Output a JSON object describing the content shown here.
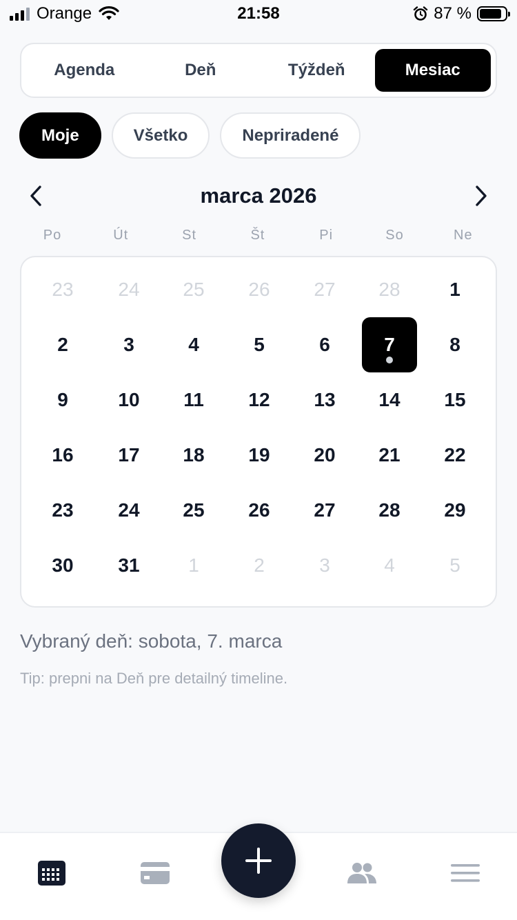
{
  "status_bar": {
    "carrier": "Orange",
    "time": "21:58",
    "battery": "87 %",
    "battery_level": 0.87
  },
  "view_switch": {
    "tabs": [
      {
        "label": "Agenda",
        "active": false
      },
      {
        "label": "Deň",
        "active": false
      },
      {
        "label": "Týždeň",
        "active": false
      },
      {
        "label": "Mesiac",
        "active": true
      }
    ]
  },
  "filters": [
    {
      "label": "Moje",
      "active": true
    },
    {
      "label": "Všetko",
      "active": false
    },
    {
      "label": "Nepriradené",
      "active": false
    }
  ],
  "calendar": {
    "month_title": "marca 2026",
    "weekdays": [
      "Po",
      "Út",
      "St",
      "Št",
      "Pi",
      "So",
      "Ne"
    ],
    "weeks": [
      [
        {
          "d": "23",
          "m": true
        },
        {
          "d": "24",
          "m": true
        },
        {
          "d": "25",
          "m": true
        },
        {
          "d": "26",
          "m": true
        },
        {
          "d": "27",
          "m": true
        },
        {
          "d": "28",
          "m": true
        },
        {
          "d": "1",
          "m": false
        }
      ],
      [
        {
          "d": "2",
          "m": false
        },
        {
          "d": "3",
          "m": false
        },
        {
          "d": "4",
          "m": false
        },
        {
          "d": "5",
          "m": false
        },
        {
          "d": "6",
          "m": false
        },
        {
          "d": "7",
          "m": false,
          "selected": true,
          "event": true
        },
        {
          "d": "8",
          "m": false
        }
      ],
      [
        {
          "d": "9",
          "m": false
        },
        {
          "d": "10",
          "m": false
        },
        {
          "d": "11",
          "m": false
        },
        {
          "d": "12",
          "m": false
        },
        {
          "d": "13",
          "m": false
        },
        {
          "d": "14",
          "m": false
        },
        {
          "d": "15",
          "m": false
        }
      ],
      [
        {
          "d": "16",
          "m": false
        },
        {
          "d": "17",
          "m": false
        },
        {
          "d": "18",
          "m": false
        },
        {
          "d": "19",
          "m": false
        },
        {
          "d": "20",
          "m": false
        },
        {
          "d": "21",
          "m": false
        },
        {
          "d": "22",
          "m": false
        }
      ],
      [
        {
          "d": "23",
          "m": false
        },
        {
          "d": "24",
          "m": false
        },
        {
          "d": "25",
          "m": false
        },
        {
          "d": "26",
          "m": false
        },
        {
          "d": "27",
          "m": false
        },
        {
          "d": "28",
          "m": false
        },
        {
          "d": "29",
          "m": false
        }
      ],
      [
        {
          "d": "30",
          "m": false
        },
        {
          "d": "31",
          "m": false
        },
        {
          "d": "1",
          "m": true
        },
        {
          "d": "2",
          "m": true
        },
        {
          "d": "3",
          "m": true
        },
        {
          "d": "4",
          "m": true
        },
        {
          "d": "5",
          "m": true
        }
      ]
    ]
  },
  "selected_day_text": "Vybraný deň: sobota, 7. marca",
  "tip_text": "Tip: prepni na Deň pre detailný timeline.",
  "tabbar": {
    "items": [
      {
        "icon": "calendar-icon",
        "active": true
      },
      {
        "icon": "card-icon",
        "active": false
      },
      {
        "icon": "plus-icon",
        "active": false
      },
      {
        "icon": "people-icon",
        "active": false
      },
      {
        "icon": "menu-icon",
        "active": false
      }
    ]
  },
  "colors": {
    "accent": "#000000",
    "fab": "#141b2d",
    "muted_text": "#6b7280",
    "inactive_icon": "#a9b0bb"
  }
}
